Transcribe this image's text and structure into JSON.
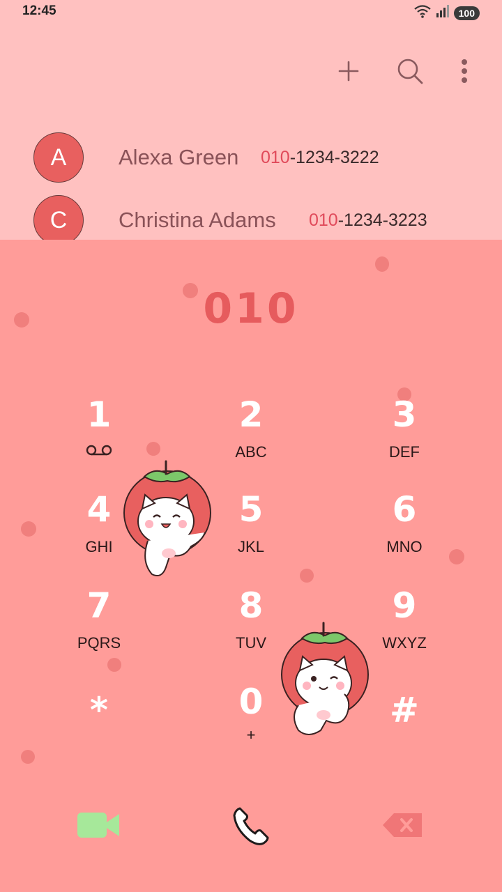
{
  "status_bar": {
    "time": "12:45",
    "battery": "100",
    "icons": [
      "wifi-icon",
      "signal-icon",
      "battery-icon"
    ]
  },
  "toolbar": {
    "icons": [
      "add-icon",
      "search-icon",
      "more-icon"
    ]
  },
  "contacts": [
    {
      "initial": "A",
      "name": "Alexa Green",
      "number_prefix": "010",
      "number_rest": "-1234-3222"
    },
    {
      "initial": "C",
      "name": "Christina Adams",
      "number_prefix": "010",
      "number_rest": "-1234-3223"
    }
  ],
  "dialer": {
    "entered_number": "010",
    "keys": [
      {
        "digit": "1",
        "letters": ""
      },
      {
        "digit": "2",
        "letters": "ABC"
      },
      {
        "digit": "3",
        "letters": "DEF"
      },
      {
        "digit": "4",
        "letters": "GHI"
      },
      {
        "digit": "5",
        "letters": "JKL"
      },
      {
        "digit": "6",
        "letters": "MNO"
      },
      {
        "digit": "7",
        "letters": "PQRS"
      },
      {
        "digit": "8",
        "letters": "TUV"
      },
      {
        "digit": "9",
        "letters": "WXYZ"
      },
      {
        "digit": "*",
        "letters": ""
      },
      {
        "digit": "0",
        "letters": "+"
      },
      {
        "digit": "#",
        "letters": ""
      }
    ],
    "voicemail_icon": "voicemail-icon"
  },
  "bottom_bar": {
    "icons": [
      "video-call-icon",
      "call-icon",
      "backspace-icon"
    ]
  },
  "colors": {
    "top_bg": "#ffc1c0",
    "dialer_bg": "#ff9c99",
    "avatar": "#e8605f",
    "accent": "#e65b5d",
    "video": "#a6e89a"
  }
}
